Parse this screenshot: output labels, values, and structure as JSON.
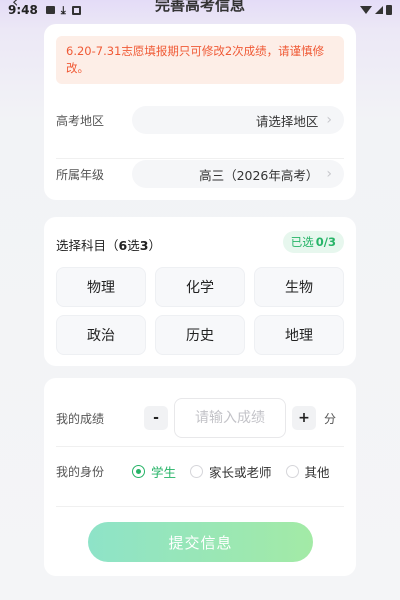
{
  "status_bar": {
    "time": "9:48"
  },
  "nav": {
    "title": "完善高考信息"
  },
  "notice": {
    "text": "6.20-7.31志愿填报期只可修改2次成绩，请谨慎修改。"
  },
  "region": {
    "label": "高考地区",
    "value": "请选择地区"
  },
  "grade": {
    "label": "所属年级",
    "value": "高三（2026年高考）"
  },
  "subjects": {
    "title_prefix": "选择科目（",
    "title_rule": "6",
    "title_mid": "选",
    "title_count": "3",
    "title_suffix": "）",
    "selected_prefix": "已选",
    "selected_count": "0/3",
    "items": [
      "物理",
      "化学",
      "生物",
      "政治",
      "历史",
      "地理"
    ]
  },
  "score": {
    "label": "我的成绩",
    "minus": "-",
    "placeholder": "请输入成绩",
    "plus": "+",
    "unit": "分"
  },
  "identity": {
    "label": "我的身份",
    "options": [
      "学生",
      "家长或老师",
      "其他"
    ],
    "selected": "学生"
  },
  "submit": {
    "label": "提交信息"
  },
  "colors": {
    "accent_green": "#26b367",
    "notice_text": "#f05a36",
    "notice_bg": "#fdeee7"
  }
}
